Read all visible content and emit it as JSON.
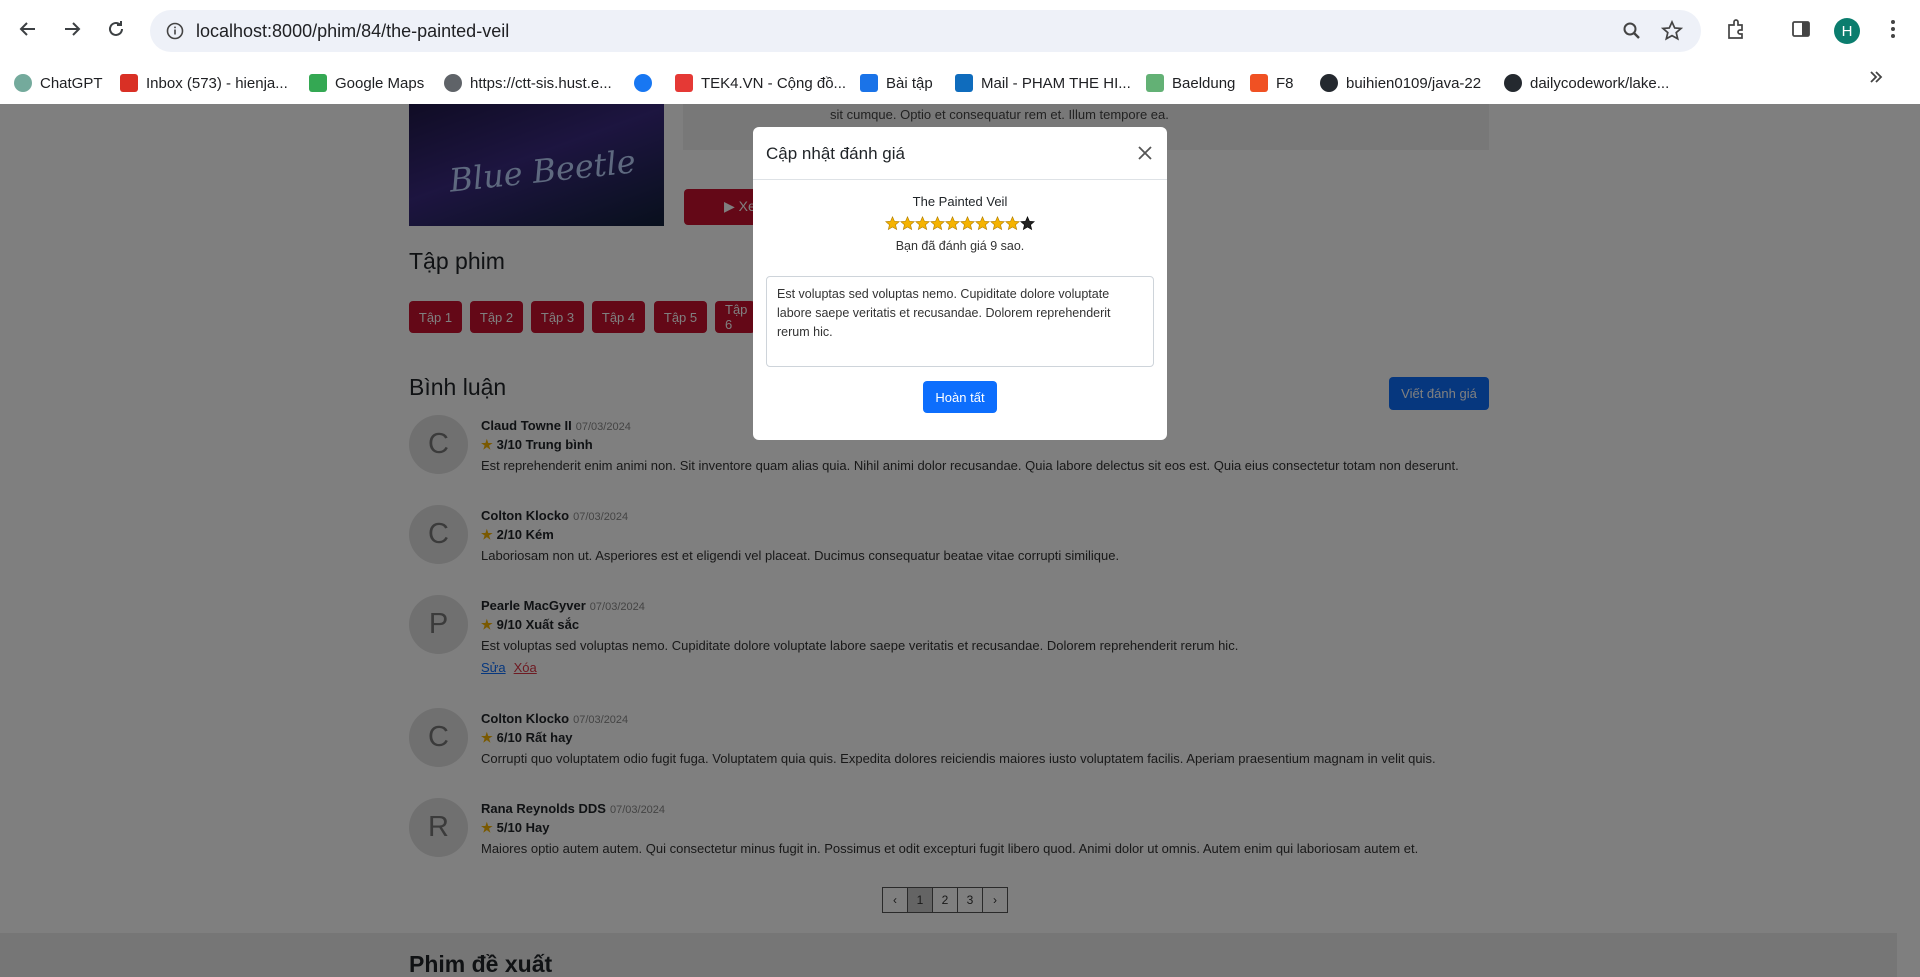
{
  "browser": {
    "url": "localhost:8000/phim/84/the-painted-veil",
    "profile_initial": "H",
    "bookmarks": [
      {
        "label": "ChatGPT",
        "icon": "chatgpt-icon",
        "color": "#74aa9c"
      },
      {
        "label": "Inbox (573) - hienja...",
        "icon": "gmail-icon",
        "color": "#d93025"
      },
      {
        "label": "Google Maps",
        "icon": "maps-icon",
        "color": "#34a853"
      },
      {
        "label": "https://ctt-sis.hust.e...",
        "icon": "globe-icon",
        "color": "#5f6368"
      },
      {
        "label": "",
        "icon": "facebook-icon",
        "color": "#1877f2"
      },
      {
        "label": "TEK4.VN - Cộng đồ...",
        "icon": "tek4-icon",
        "color": "#e53935"
      },
      {
        "label": "Bài tập",
        "icon": "trello-icon",
        "color": "#1a73e8"
      },
      {
        "label": "Mail - PHAM THE HI...",
        "icon": "outlook-icon",
        "color": "#0f6cbd"
      },
      {
        "label": "Baeldung",
        "icon": "baeldung-icon",
        "color": "#63b175"
      },
      {
        "label": "F8",
        "icon": "f8-icon",
        "color": "#f05123"
      },
      {
        "label": "buihien0109/java-22",
        "icon": "github-icon",
        "color": "#24292f"
      },
      {
        "label": "dailycodework/lake...",
        "icon": "github-icon",
        "color": "#24292f"
      }
    ]
  },
  "movie": {
    "poster_title": "Blue Beetle",
    "description_tail": "sit cumque. Optio et consequatur rem et. Illum tempore ea.",
    "watch_label": "▶ Xe"
  },
  "episodes": {
    "title": "Tập phim",
    "items": [
      "Tập 1",
      "Tập 2",
      "Tập 3",
      "Tập 4",
      "Tập 5",
      "Tập 6"
    ]
  },
  "comments": {
    "title": "Bình luận",
    "write_label": "Viết đánh giá",
    "edit_label": "Sửa",
    "delete_label": "Xóa",
    "items": [
      {
        "initial": "C",
        "name": "Claud Towne II",
        "date": "07/03/2024",
        "rating": "3/10 Trung bình",
        "text": "Est reprehenderit enim animi non. Sit inventore quam alias quia. Nihil animi dolor recusandae. Quia labore delectus sit eos est. Quia eius consectetur totam non deserunt."
      },
      {
        "initial": "C",
        "name": "Colton Klocko",
        "date": "07/03/2024",
        "rating": "2/10 Kém",
        "text": "Laboriosam non ut. Asperiores est et eligendi vel placeat. Ducimus consequatur beatae vitae corrupti similique."
      },
      {
        "initial": "P",
        "name": "Pearle MacGyver",
        "date": "07/03/2024",
        "rating": "9/10 Xuất sắc",
        "text": "Est voluptas sed voluptas nemo. Cupiditate dolore voluptate labore saepe veritatis et recusandae. Dolorem reprehenderit rerum hic."
      },
      {
        "initial": "C",
        "name": "Colton Klocko",
        "date": "07/03/2024",
        "rating": "6/10 Rất hay",
        "text": "Corrupti quo voluptatem odio fugit fuga. Voluptatem quia quis. Expedita dolores reiciendis maiores iusto voluptatem facilis. Aperiam praesentium magnam in velit quis."
      },
      {
        "initial": "R",
        "name": "Rana Reynolds DDS",
        "date": "07/03/2024",
        "rating": "5/10 Hay",
        "text": "Maiores optio autem autem. Qui consectetur minus fugit in. Possimus et odit excepturi fugit libero quod. Animi dolor ut omnis. Autem enim qui laboriosam autem et."
      }
    ]
  },
  "pagination": {
    "prev": "‹",
    "pages": [
      "1",
      "2",
      "3"
    ],
    "next": "›",
    "current": "1"
  },
  "suggest": {
    "title": "Phim đề xuất"
  },
  "modal": {
    "title": "Cập nhật đánh giá",
    "movie_name": "The Painted Veil",
    "stars_total": 10,
    "stars_selected": 9,
    "rated_text": "Bạn đã đánh giá 9 sao.",
    "review_text": "Est voluptas sed voluptas nemo. Cupiditate dolore voluptate labore saepe veritatis et recusandae. Dolorem reprehenderit rerum hic.",
    "submit_label": "Hoàn tất",
    "star_color": "#f5b301",
    "star_empty_color": "#222222"
  }
}
